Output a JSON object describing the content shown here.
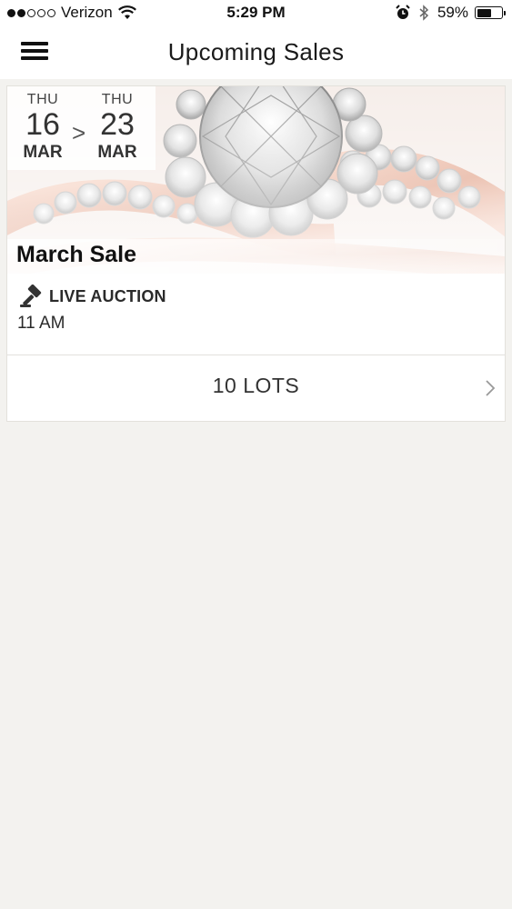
{
  "status_bar": {
    "carrier": "Verizon",
    "time": "5:29 PM",
    "battery_percent": "59%",
    "battery_level": 0.59,
    "signal_bars": 2
  },
  "nav": {
    "title": "Upcoming Sales",
    "menu_icon": "hamburger-menu-icon"
  },
  "sales": [
    {
      "start": {
        "dow": "THU",
        "day": "16",
        "month": "MAR"
      },
      "arrow": ">",
      "end": {
        "dow": "THU",
        "day": "23",
        "month": "MAR"
      },
      "title": "March Sale",
      "auction_type": "LIVE AUCTION",
      "auction_icon": "gavel-icon",
      "time": "11 AM",
      "lots_label": "10 LOTS",
      "image_subject": "rose gold diamond halo engagement ring"
    }
  ],
  "colors": {
    "background": "#f3f2ef",
    "card": "#ffffff",
    "rose_gold": "#e9b5a0"
  }
}
